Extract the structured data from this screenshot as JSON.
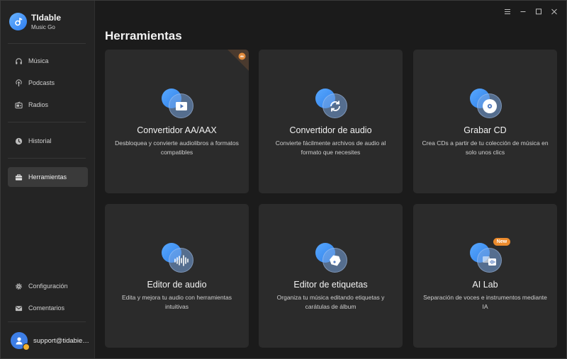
{
  "app": {
    "name": "TIdable",
    "subtitle": "Music Go"
  },
  "sidebar": {
    "items": [
      {
        "label": "Música",
        "icon": "headphones-icon"
      },
      {
        "label": "Podcasts",
        "icon": "podcast-icon"
      },
      {
        "label": "Radios",
        "icon": "radio-icon"
      },
      {
        "label": "Historial",
        "icon": "clock-icon"
      },
      {
        "label": "Herramientas",
        "icon": "toolbox-icon",
        "active": true
      }
    ],
    "bottom_items": [
      {
        "label": "Configuración",
        "icon": "gear-icon"
      },
      {
        "label": "Comentarios",
        "icon": "mail-icon"
      }
    ],
    "account": {
      "email": "support@tidabie…"
    }
  },
  "main": {
    "title": "Herramientas",
    "tools": [
      {
        "title": "Convertidor AA/AAX",
        "desc": "Desbloquea y convierte audiolibros a formatos compatibles",
        "icon": "video-play-icon"
      },
      {
        "title": "Convertidor de audio",
        "desc": "Convierte fácilmente archivos de audio al formato que necesites",
        "icon": "sync-icon"
      },
      {
        "title": "Grabar CD",
        "desc": "Crea CDs a partir de tu colección de música en solo unos clics",
        "icon": "disc-icon"
      },
      {
        "title": "Editor de audio",
        "desc": "Edita y mejora tu audio con herramientas intuitivas",
        "icon": "waveform-icon"
      },
      {
        "title": "Editor de etiquetas",
        "desc": "Organiza tu música editando etiquetas y carátulas de álbum",
        "icon": "tag-icon"
      },
      {
        "title": "AI Lab",
        "desc": "Separación de voces e instrumentos mediante IA",
        "icon": "ai-icon",
        "badge": "New"
      }
    ]
  },
  "colors": {
    "accent": "#3d8ef0",
    "badge_new": "#ec8b2d",
    "card_bg": "#2b2b2b",
    "sidebar_bg": "#242424"
  }
}
